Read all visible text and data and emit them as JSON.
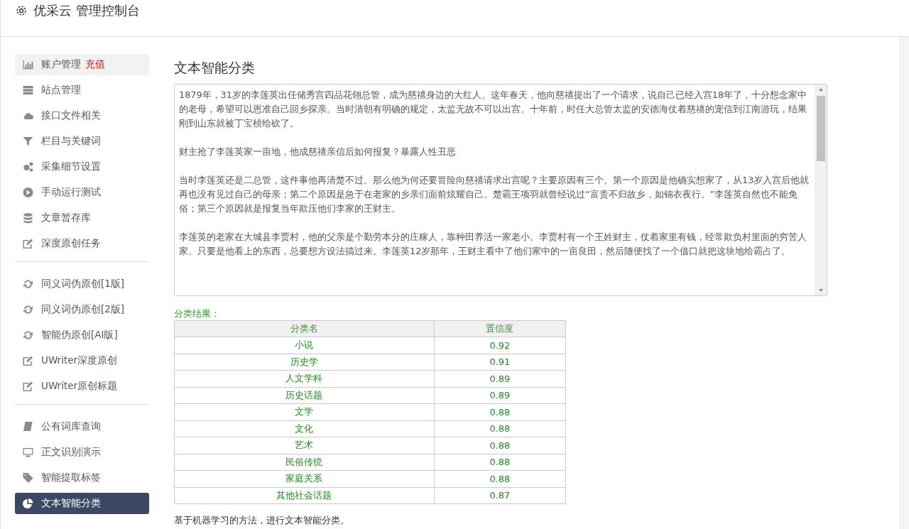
{
  "header": {
    "title": "优采云 管理控制台"
  },
  "sidebar": {
    "groups": [
      {
        "items": [
          {
            "label": "账户管理",
            "badge": "充值",
            "highlighted": true,
            "selected": false
          },
          {
            "label": "站点管理",
            "highlighted": false,
            "selected": false
          },
          {
            "label": "接口文件相关",
            "highlighted": false,
            "selected": false
          },
          {
            "label": "栏目与关键词",
            "highlighted": false,
            "selected": false
          },
          {
            "label": "采集细节设置",
            "highlighted": false,
            "selected": false
          },
          {
            "label": "手动运行测试",
            "highlighted": false,
            "selected": false
          },
          {
            "label": "文章暂存库",
            "highlighted": false,
            "selected": false
          },
          {
            "label": "深度原创任务",
            "highlighted": false,
            "selected": false
          }
        ]
      },
      {
        "items": [
          {
            "label": "同义词伪原创[1版]",
            "highlighted": false,
            "selected": false
          },
          {
            "label": "同义词伪原创[2版]",
            "highlighted": false,
            "selected": false
          },
          {
            "label": "智能伪原创[AI版]",
            "highlighted": false,
            "selected": false
          },
          {
            "label": "UWriter深度原创",
            "highlighted": false,
            "selected": false
          },
          {
            "label": "UWriter原创标题",
            "highlighted": false,
            "selected": false
          }
        ]
      },
      {
        "items": [
          {
            "label": "公有词库查询",
            "highlighted": false,
            "selected": false
          },
          {
            "label": "正文识别演示",
            "highlighted": false,
            "selected": false
          },
          {
            "label": "智能提取标签",
            "highlighted": false,
            "selected": false
          },
          {
            "label": "文本智能分类",
            "highlighted": false,
            "selected": true
          }
        ]
      }
    ]
  },
  "main": {
    "title": "文本智能分类",
    "text_area": {
      "paragraphs": [
        "1879年，31岁的李莲英出任储秀宫四品花翎总管，成为慈禧身边的大红人。这年春天，他向慈禧提出了一个请求，说自己已经入宫18年了，十分想念家中的老母，希望可以恩准自己回乡探亲。当时清朝有明确的规定，太监无故不可以出宫。十年前，时任大总管太监的安德海仗着慈禧的宠信到江南游玩，结果刚到山东就被丁宝桢给砍了。",
        "财主抢了李莲英家一亩地，他成慈禧亲信后如何报复？暴露人性丑恶",
        "当时李莲英还是二总管，这件事他再清楚不过。那么他为何还要冒险向慈禧请求出宫呢？主要原因有三个。第一个原因是他确实想家了，从13岁入宫后他就再也没有见过自己的母亲；第二个原因是急于在老家的乡亲们面前炫耀自己。楚霸王项羽就曾经说过“富贵不归故乡，如锦衣夜行。”李莲英自然也不能免俗；第三个原因就是报复当年欺压他们李家的王财主。",
        "李莲英的老家在大城县李贾村，他的父亲是个勤劳本分的庄稼人，靠种田养活一家老小。李贾村有一个王姓财主，仗着家里有钱，经常欺负村里面的穷苦人家。只要是他看上的东西，总要想方设法搞过来。李莲英12岁那年，王财主看中了他们家中的一亩良田，然后随便找了一个借口就把这块地给霸占了。"
      ]
    },
    "result_label": "分类结果：",
    "table": {
      "columns": [
        "分类名",
        "置信度"
      ],
      "rows": [
        [
          "小说",
          "0.92"
        ],
        [
          "历史学",
          "0.91"
        ],
        [
          "人文学科",
          "0.89"
        ],
        [
          "历史话题",
          "0.89"
        ],
        [
          "文学",
          "0.88"
        ],
        [
          "文化",
          "0.88"
        ],
        [
          "艺术",
          "0.88"
        ],
        [
          "民俗传统",
          "0.88"
        ],
        [
          "家庭关系",
          "0.88"
        ],
        [
          "其他社会话题",
          "0.87"
        ]
      ]
    },
    "note": "基于机器学习的方法，进行文本智能分类。"
  }
}
